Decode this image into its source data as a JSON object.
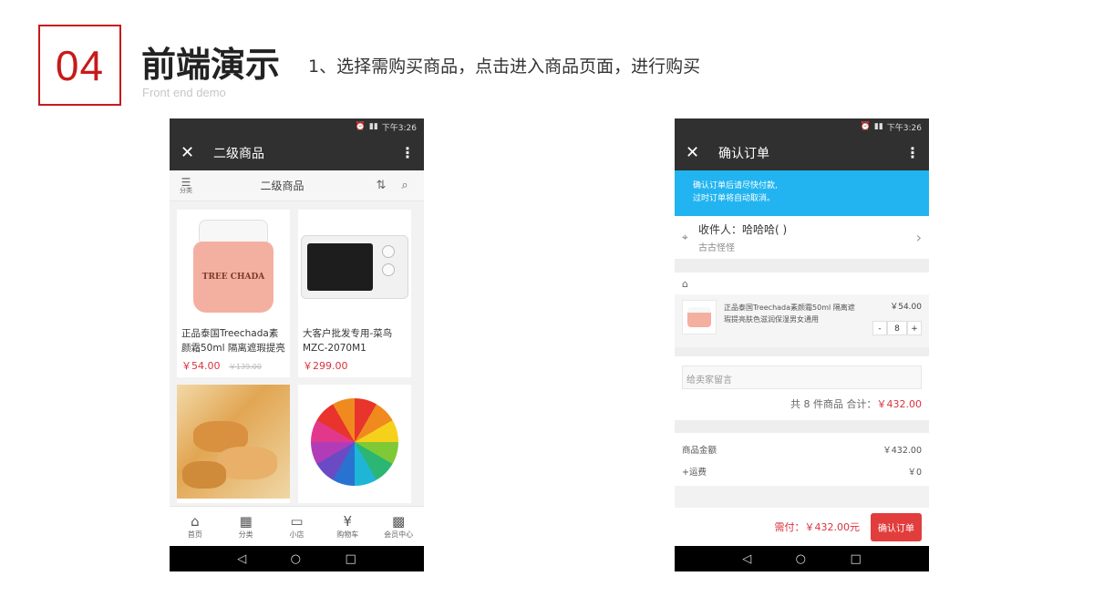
{
  "slide": {
    "number": "04",
    "title": "前端演示",
    "subtitle_en": "Front end demo",
    "description": "1、选择需购买商品，点击进入商品页面，进行购买",
    "accent_color": "#c81a1a"
  },
  "left_phone": {
    "status_time": "下午3:26",
    "appbar": {
      "close_icon": "close-icon",
      "title": "二级商品",
      "more_icon": "more-vertical-icon"
    },
    "subbar": {
      "category_label": "分类",
      "title": "二级商品"
    },
    "products": [
      {
        "name": "正品泰国Treechada素颜霜50ml 隔离遮瑕提亮肤",
        "price": "￥54.00",
        "old_price": "￥139.00",
        "image": "cream-jar",
        "brand": "TREE CHADA"
      },
      {
        "name": "大客户批发专用-菜鸟MZC-2070M1",
        "price": "￥299.00",
        "old_price": "",
        "image": "microwave"
      },
      {
        "name": "",
        "price": "",
        "old_price": "",
        "image": "biscuits"
      },
      {
        "name": "",
        "price": "",
        "old_price": "",
        "image": "umbrella"
      }
    ],
    "tabs": [
      {
        "label": "首页",
        "icon": "store-icon"
      },
      {
        "label": "分类",
        "icon": "grid-icon"
      },
      {
        "label": "小店",
        "icon": "ticket-icon"
      },
      {
        "label": "购物车",
        "icon": "cart-icon"
      },
      {
        "label": "会员中心",
        "icon": "qrcode-icon"
      }
    ]
  },
  "right_phone": {
    "status_time": "下午3:26",
    "appbar": {
      "close_icon": "close-icon",
      "title": "确认订单",
      "more_icon": "more-vertical-icon"
    },
    "notice": {
      "line1": "确认订单后请尽快付款,",
      "line2": "过时订单将自动取消。",
      "color": "#22b4f0"
    },
    "address": {
      "recipient": "收件人：哈哈哈(                    )",
      "location": "古古怪怪"
    },
    "item": {
      "name": "正品泰国Treechada素颜霜50ml 隔离遮瑕提亮肤色滋润保湿男女通用",
      "price": "￥54.00",
      "minus": "-",
      "qty": "8",
      "plus": "+"
    },
    "memo_placeholder": "给卖家留言",
    "summary": {
      "prefix": "共 8 件商品 合计：",
      "amount": "￥432.00"
    },
    "fees": [
      {
        "label": "商品金额",
        "value": "￥432.00"
      },
      {
        "label": "+运费",
        "value": "￥0"
      }
    ],
    "pay": {
      "total": "需付：￥432.00元",
      "button": "确认订单",
      "color": "#e23d3d"
    }
  }
}
